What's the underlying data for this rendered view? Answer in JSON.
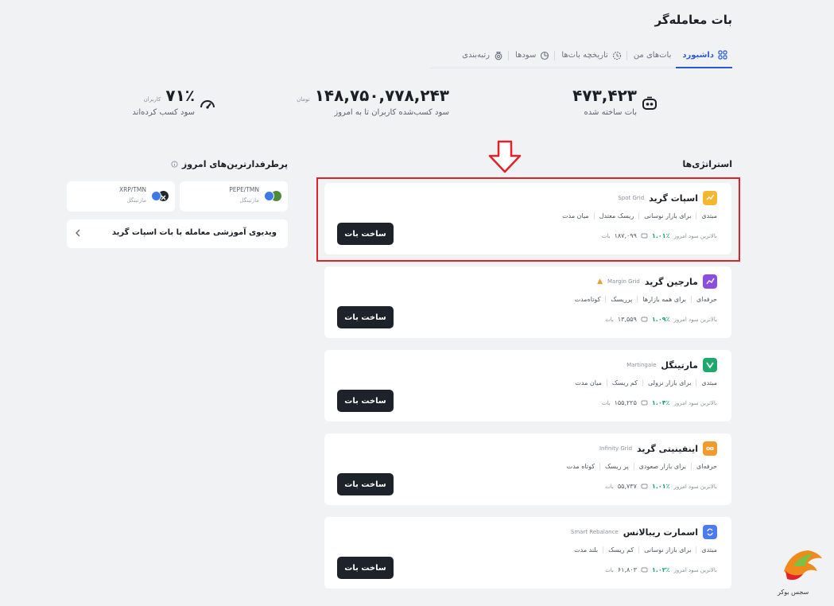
{
  "page": {
    "title": "بات معامله‌گر"
  },
  "tabs": [
    {
      "label": "داشبورد",
      "icon": "grid-icon",
      "active": true
    },
    {
      "label": "بات‌های من",
      "icon": "",
      "active": false
    },
    {
      "label": "تاریخچه بات‌ها",
      "icon": "history-icon",
      "active": false
    },
    {
      "label": "سودها",
      "icon": "pie-icon",
      "active": false
    },
    {
      "label": "رتبه‌بندی",
      "icon": "medal-icon",
      "active": false
    }
  ],
  "stats": {
    "bots": {
      "value": "۴۷۳,۴۲۳",
      "label": "بات ساخته شده",
      "icon": "robot-icon"
    },
    "profit": {
      "value": "۱۴۸,۷۵۰,۷۷۸,۲۴۳",
      "unit": "تومان",
      "label": "سود کسب‌شده کاربران تا به امروز"
    },
    "users": {
      "value": "۷۱٪",
      "unit": "کاربران",
      "label": "سود کسب کرده‌اند",
      "icon": "gauge-icon"
    }
  },
  "strategies": {
    "title": "استراتژی‌ها",
    "button_label": "ساخت بات",
    "profit_label": "بالاترین سود امروز",
    "bots_suffix": "بات",
    "items": [
      {
        "name": "اسپات گرید",
        "en": "Spot Grid",
        "tags": [
          "مبتدی",
          "برای بازار نوسانی",
          "ریسک معتدل",
          "میان مدت"
        ],
        "pct": "۱.۰۱٪",
        "count": "۱۸۷,۰۹۹",
        "icon_color": "#f5b731",
        "icon": "spot-grid-icon"
      },
      {
        "name": "مارجین گرید",
        "en": "Margin Grid",
        "tags": [
          "حرفه‌ای",
          "برای همه بازارها",
          "پرریسک",
          "کوتاه‌مدت"
        ],
        "pct": "۱.۰۹٪",
        "count": "۱۳,۵۵۹",
        "icon_color": "#8b4fe0",
        "icon": "margin-grid-icon"
      },
      {
        "name": "مارتینگل",
        "en": "Martingale",
        "tags": [
          "مبتدی",
          "برای بازار نزولی",
          "کم ریسک",
          "میان مدت"
        ],
        "pct": "۱.۰۴٪",
        "count": "۱۵۵,۲۲۵",
        "icon_color": "#1fa86e",
        "icon": "martingale-icon"
      },
      {
        "name": "اینفینیتی گرید",
        "en": "Infinity Grid",
        "tags": [
          "حرفه‌ای",
          "برای بازار صعودی",
          "پر ریسک",
          "کوتاه مدت"
        ],
        "pct": "۱.۰۱٪",
        "count": "۵۵,۷۳۷",
        "icon_color": "#f29a2a",
        "icon": "infinity-icon"
      },
      {
        "name": "اسمارت ریبالانس",
        "en": "Smart Rebalance",
        "tags": [
          "مبتدی",
          "برای بازار نوسانی",
          "کم ریسک",
          "بلند مدت"
        ],
        "pct": "۱.۰۲٪",
        "count": "۶۱,۸۰۳",
        "icon_color": "#4a7cf0",
        "icon": "rebalance-icon"
      }
    ]
  },
  "popular": {
    "title": "پرطرفدارترین‌های امروز",
    "pairs": [
      {
        "name": "PEPE/TMN",
        "type": "مارتینگل"
      },
      {
        "name": "XRP/TMN",
        "type": "مارتینگل"
      }
    ],
    "video": "ویدیوی آموزشی معامله با بات اسپات گرید"
  },
  "watermark": {
    "text": "سجس بوکر"
  }
}
